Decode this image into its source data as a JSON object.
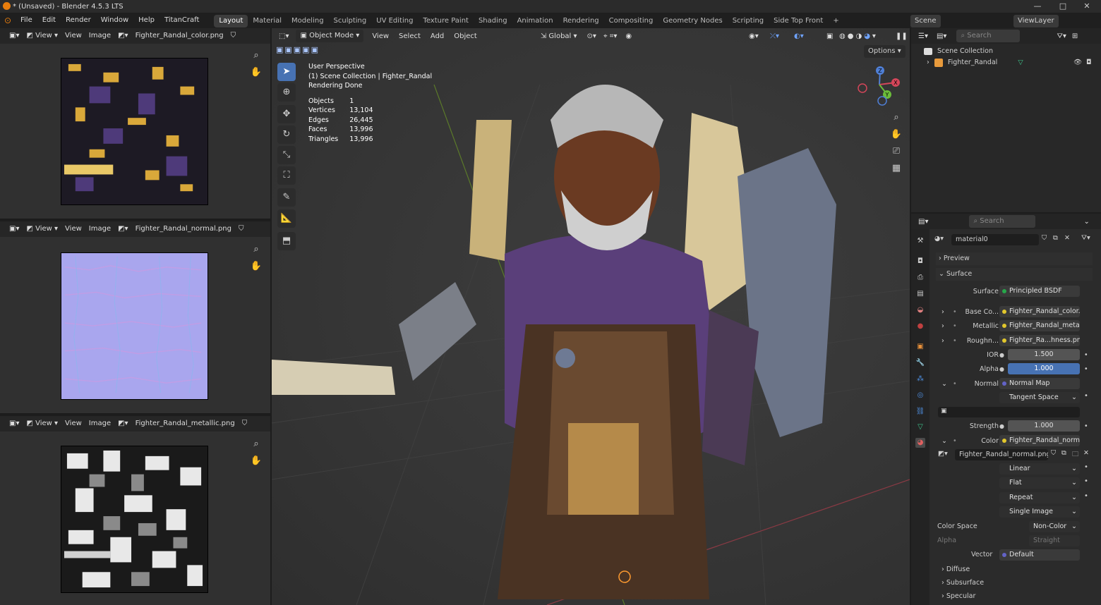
{
  "window": {
    "title": "* (Unsaved) - Blender 4.5.3 LTS",
    "controls": [
      "—",
      "□",
      "✕"
    ]
  },
  "menu": [
    "File",
    "Edit",
    "Render",
    "Window",
    "Help",
    "TitanCraft"
  ],
  "workspaces": [
    "Layout",
    "Material",
    "Modeling",
    "Sculpting",
    "UV Editing",
    "Texture Paint",
    "Shading",
    "Animation",
    "Rendering",
    "Compositing",
    "Geometry Nodes",
    "Scripting",
    "Side Top Front",
    "+"
  ],
  "active_workspace": "Layout",
  "scene": "Scene",
  "view_layer": "ViewLayer",
  "image_editors": [
    {
      "view": "View",
      "view2": "View",
      "image": "Image",
      "file": "Fighter_Randal_color.png"
    },
    {
      "view": "View",
      "view2": "View",
      "image": "Image",
      "file": "Fighter_Randal_normal.png"
    },
    {
      "view": "View",
      "view2": "View",
      "image": "Image",
      "file": "Fighter_Randal_metallic.png"
    }
  ],
  "viewport": {
    "mode": "Object Mode",
    "menus": [
      "View",
      "Select",
      "Add",
      "Object"
    ],
    "orientation": "Global",
    "options": "Options",
    "overlay_lines": [
      "User Perspective",
      "(1) Scene Collection | Fighter_Randal",
      "Rendering Done"
    ],
    "stats": [
      [
        "Objects",
        "1"
      ],
      [
        "Vertices",
        "13,104"
      ],
      [
        "Edges",
        "26,445"
      ],
      [
        "Faces",
        "13,996"
      ],
      [
        "Triangles",
        "13,996"
      ]
    ],
    "gizmo": {
      "z": "Z",
      "y": "Y",
      "x": "X"
    }
  },
  "outliner": {
    "search": "Search",
    "collection": "Scene Collection",
    "object": "Fighter_Randal"
  },
  "properties": {
    "search": "Search",
    "material": "material0",
    "sections": {
      "preview": "Preview",
      "surface": "Surface",
      "diffuse": "Diffuse",
      "subsurface": "Subsurface",
      "specular": "Specular"
    },
    "rows": [
      {
        "label": "Surface",
        "value": "Principled BSDF",
        "dot": "#27a84b"
      },
      {
        "label": "Base Co...",
        "value": "Fighter_Randal_color...",
        "dot": "#e2c72c"
      },
      {
        "label": "Metallic",
        "value": "Fighter_Randal_metal...",
        "dot": "#e2c72c"
      },
      {
        "label": "Roughn...",
        "value": "Fighter_Ra...hness.png",
        "dot": "#e2c72c"
      },
      {
        "label": "IOR",
        "value": "1.500",
        "dot": "#a0a0a0"
      },
      {
        "label": "Alpha",
        "value": "1.000",
        "dot": "#a0a0a0"
      },
      {
        "label": "Normal",
        "value": "Normal Map",
        "dot": "#6363c7"
      },
      {
        "label": "",
        "value": "Tangent Space",
        "dot": ""
      },
      {
        "label": "Strength",
        "value": "1.000",
        "dot": "#a0a0a0"
      },
      {
        "label": "Color",
        "value": "Fighter_Randal_norm...",
        "dot": "#e2c72c"
      }
    ],
    "image_node": "Fighter_Randal_normal.png",
    "dropdowns": [
      "Linear",
      "Flat",
      "Repeat",
      "Single Image"
    ],
    "color_space_label": "Color Space",
    "color_space": "Non-Color",
    "alpha_label": "Alpha",
    "alpha": "Straight",
    "vector_label": "Vector",
    "vector": "Default"
  }
}
